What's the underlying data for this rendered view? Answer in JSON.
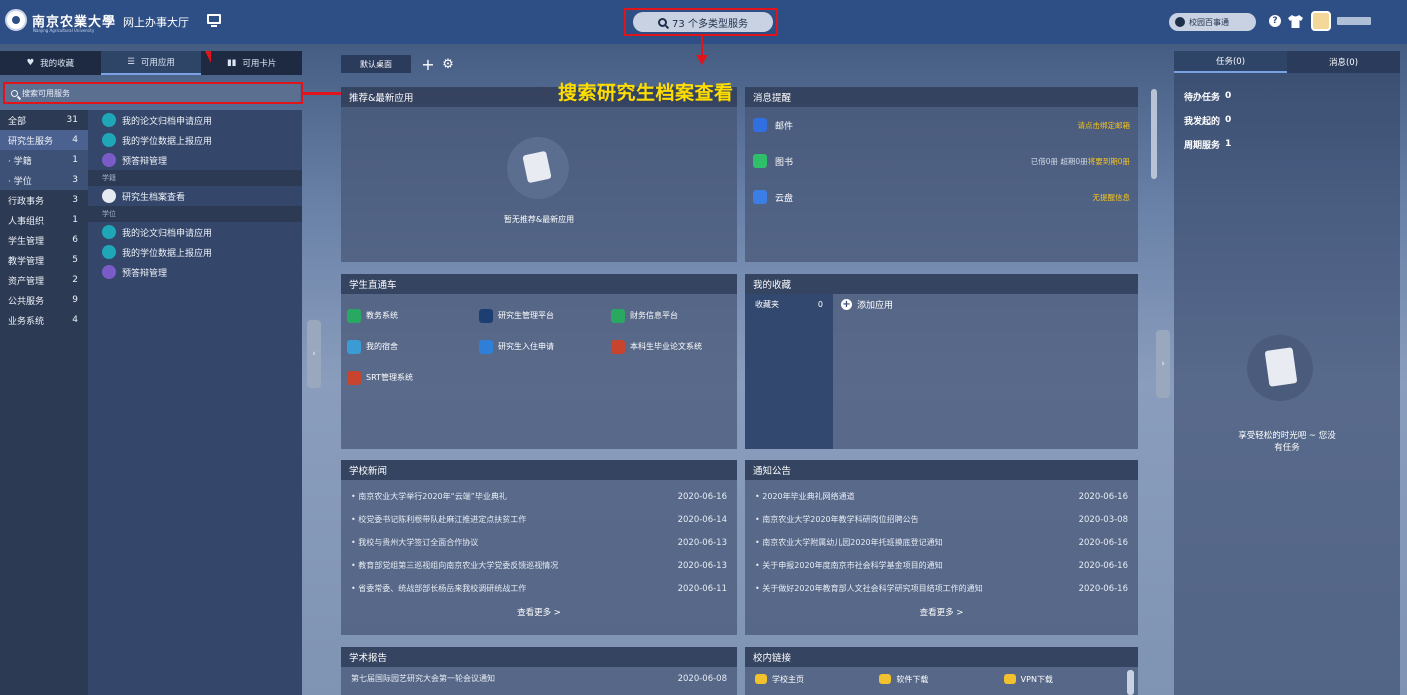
{
  "header": {
    "school_name": "南京农業大學",
    "school_name_en": "Nanjing Agricultural University",
    "hall": "网上办事大厅",
    "search_label": "73 个多类型服务",
    "campus_btn": "校园百事通"
  },
  "left": {
    "tabs": [
      {
        "label": "我的收藏"
      },
      {
        "label": "可用应用"
      },
      {
        "label": "可用卡片"
      }
    ],
    "search_placeholder": "搜索可用服务",
    "categories": [
      {
        "label": "全部",
        "count": "31"
      },
      {
        "label": "研究生服务",
        "count": "4"
      },
      {
        "label": "· 学籍",
        "count": "1"
      },
      {
        "label": "· 学位",
        "count": "3"
      },
      {
        "label": "行政事务",
        "count": "3"
      },
      {
        "label": "人事组织",
        "count": "1"
      },
      {
        "label": "学生管理",
        "count": "6"
      },
      {
        "label": "教学管理",
        "count": "5"
      },
      {
        "label": "资产管理",
        "count": "2"
      },
      {
        "label": "公共服务",
        "count": "9"
      },
      {
        "label": "业务系统",
        "count": "4"
      }
    ],
    "apps": [
      {
        "label": "我的论文归档申请应用",
        "grp": false
      },
      {
        "label": "我的学位数据上报应用",
        "grp": false
      },
      {
        "label": "预答辩管理",
        "grp": false
      },
      {
        "label": "学籍",
        "grp": true
      },
      {
        "label": "研究生档案查看",
        "grp": false
      },
      {
        "label": "学位",
        "grp": true
      },
      {
        "label": "我的论文归档申请应用",
        "grp": false
      },
      {
        "label": "我的学位数据上报应用",
        "grp": false
      },
      {
        "label": "预答辩管理",
        "grp": false
      }
    ]
  },
  "annotation": {
    "text": "搜索研究生档案查看"
  },
  "desk": {
    "tab": "默认桌面"
  },
  "recommend": {
    "title": "推荐&最新应用",
    "empty": "暂无推荐&最新应用"
  },
  "messages": {
    "title": "消息提醒",
    "rows": [
      {
        "label": "邮件",
        "right": "请点击绑定邮箱",
        "right2": "",
        "color": "#2f6fe0"
      },
      {
        "label": "图书",
        "right": "已借0册 超期0册",
        "right2": "将要到期0册",
        "color": "#2fbf6a"
      },
      {
        "label": "云盘",
        "right": "无提醒信息",
        "right2": "",
        "color": "#3a7ee6"
      }
    ]
  },
  "bus": {
    "title": "学生直通车",
    "items": [
      {
        "label": "教务系统",
        "color": "#2aa862"
      },
      {
        "label": "研究生管理平台",
        "color": "#1d3e73"
      },
      {
        "label": "财务信息平台",
        "color": "#2aa862"
      },
      {
        "label": "我的宿舍",
        "color": "#3b9bd4"
      },
      {
        "label": "研究生入住申请",
        "color": "#2e7fd8"
      },
      {
        "label": "本科生毕业论文系统",
        "color": "#c7442e"
      },
      {
        "label": "SRT管理系统",
        "color": "#c7442e"
      }
    ]
  },
  "favorites": {
    "title": "我的收藏",
    "folder": "收藏夹",
    "count": "0",
    "add": "添加应用"
  },
  "news": {
    "title": "学校新闻",
    "rows": [
      {
        "t": "南京农业大学举行2020年“云端”毕业典礼",
        "d": "2020-06-16"
      },
      {
        "t": "校党委书记陈利根带队赴麻江推进定点扶贫工作",
        "d": "2020-06-14"
      },
      {
        "t": "我校与贵州大学签订全面合作协议",
        "d": "2020-06-13"
      },
      {
        "t": "教育部党组第三巡视组向南京农业大学党委反馈巡视情况",
        "d": "2020-06-13"
      },
      {
        "t": "省委常委、统战部部长杨岳来我校调研统战工作",
        "d": "2020-06-11"
      }
    ],
    "more": "查看更多 >"
  },
  "notice": {
    "title": "通知公告",
    "rows": [
      {
        "t": "2020年毕业典礼网络通道",
        "d": "2020-06-16"
      },
      {
        "t": "南京农业大学2020年教学科研岗位招聘公告",
        "d": "2020-03-08"
      },
      {
        "t": "南京农业大学附属幼儿园2020年托班摸底登记通知",
        "d": "2020-06-16"
      },
      {
        "t": "关于申报2020年度南京市社会科学基金项目的通知",
        "d": "2020-06-16"
      },
      {
        "t": "关于做好2020年教育部人文社会科学研究项目结项工作的通知",
        "d": "2020-06-16"
      }
    ],
    "more": "查看更多 >"
  },
  "report": {
    "title": "学术报告",
    "rows": [
      {
        "t": "第七届国际园艺研究大会第一轮会议通知",
        "d": "2020-06-08"
      }
    ]
  },
  "links": {
    "title": "校内链接",
    "items": [
      "学校主页",
      "软件下载",
      "VPN下载"
    ]
  },
  "right": {
    "tabs": [
      "任务(0)",
      "消息(0)"
    ],
    "tasks": [
      {
        "label": "待办任务",
        "count": "0"
      },
      {
        "label": "我发起的",
        "count": "0"
      },
      {
        "label": "周期服务",
        "count": "1"
      }
    ],
    "empty_line1": "享受轻松的时光吧 ~ 您没",
    "empty_line2": "有任务"
  }
}
